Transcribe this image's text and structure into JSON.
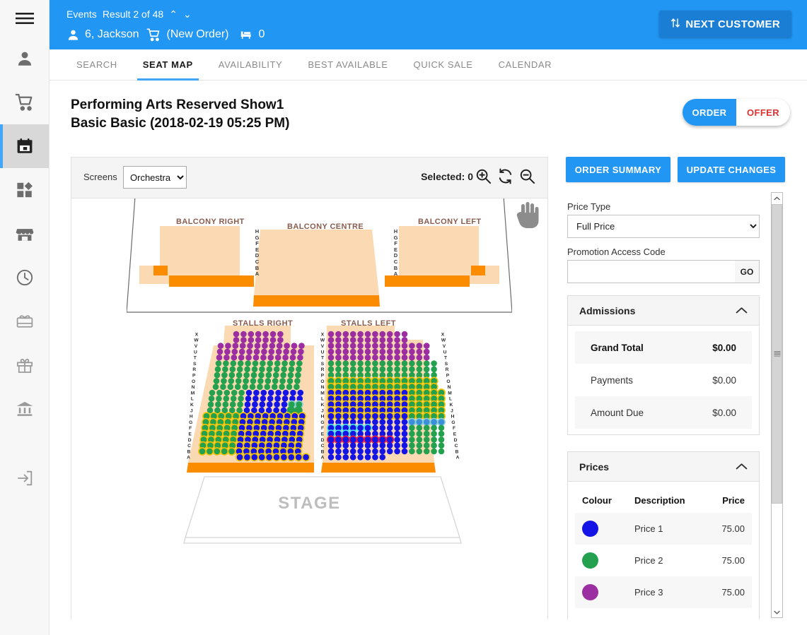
{
  "topbar": {
    "section_label": "Events",
    "result_text": "Result 2 of 48",
    "caret_up": "⌃",
    "caret_down": "⌄",
    "customer": "6, Jackson",
    "order_status": "(New Order)",
    "seat_count": "0",
    "next_customer_label": "NEXT CUSTOMER",
    "accent_color": "#2196f3",
    "button_color": "#1a7fd4"
  },
  "tabs": [
    {
      "label": "SEARCH",
      "active": false
    },
    {
      "label": "SEAT MAP",
      "active": true
    },
    {
      "label": "AVAILABILITY",
      "active": false
    },
    {
      "label": "BEST AVAILABLE",
      "active": false
    },
    {
      "label": "QUICK SALE",
      "active": false
    },
    {
      "label": "CALENDAR",
      "active": false
    }
  ],
  "page": {
    "title_line1": "Performing Arts Reserved Show1",
    "title_line2": "Basic Basic (2018-02-19 05:25 PM)",
    "order_label": "ORDER",
    "offer_label": "OFFER",
    "offer_color": "#e03131"
  },
  "map_toolbar": {
    "screens_label": "Screens",
    "screens_value": "Orchestra",
    "screens_options": [
      "Orchestra"
    ],
    "selected_text": "Selected: 0",
    "zoom_in_icon": "zoom-in-icon",
    "zoom_reset_icon": "refresh-icon",
    "zoom_out_icon": "zoom-out-icon"
  },
  "seatmap": {
    "hand_tool_icon": "hand-icon",
    "stage_label": "STAGE",
    "balcony": {
      "right_label": "BALCONY RIGHT",
      "centre_label": "BALCONY CENTRE",
      "left_label": "BALCONY LEFT",
      "row_letters": "H G F E D C B A"
    },
    "stalls": {
      "right_label": "STALLS RIGHT",
      "left_label": "STALLS LEFT",
      "row_letters": "X W V U T S R P O N M L K J H G F E D C B A"
    }
  },
  "right_panel": {
    "order_summary_label": "ORDER SUMMARY",
    "update_changes_label": "UPDATE CHANGES",
    "price_type_label": "Price Type",
    "price_type_value": "Full Price",
    "price_type_options": [
      "Full Price"
    ],
    "promo_label": "Promotion Access Code",
    "promo_value": "",
    "promo_placeholder": "",
    "go_label": "GO",
    "admissions": {
      "title": "Admissions",
      "rows": [
        {
          "label": "Grand Total",
          "value": "$0.00"
        },
        {
          "label": "Payments",
          "value": "$0.00"
        },
        {
          "label": "Amount Due",
          "value": "$0.00"
        }
      ]
    },
    "prices": {
      "title": "Prices",
      "headers": {
        "colour": "Colour",
        "description": "Description",
        "price": "Price"
      },
      "rows": [
        {
          "colour": "#1414e6",
          "description": "Price 1",
          "price": "75.00"
        },
        {
          "colour": "#23a14f",
          "description": "Price 2",
          "price": "75.00"
        },
        {
          "colour": "#9b2ea0",
          "description": "Price 3",
          "price": "75.00"
        }
      ]
    }
  },
  "sidebar": {
    "items": [
      {
        "name": "menu-icon",
        "active": false
      },
      {
        "name": "person-icon",
        "active": false
      },
      {
        "name": "cart-icon",
        "active": false
      },
      {
        "name": "calendar-icon",
        "active": true
      },
      {
        "name": "apps-icon",
        "active": false
      },
      {
        "name": "store-icon",
        "active": false
      },
      {
        "name": "clock-icon",
        "active": false
      },
      {
        "name": "voucher-icon",
        "active": false
      },
      {
        "name": "gift-icon",
        "active": false
      },
      {
        "name": "bank-icon",
        "active": false
      },
      {
        "name": "logout-icon",
        "active": false
      }
    ]
  }
}
